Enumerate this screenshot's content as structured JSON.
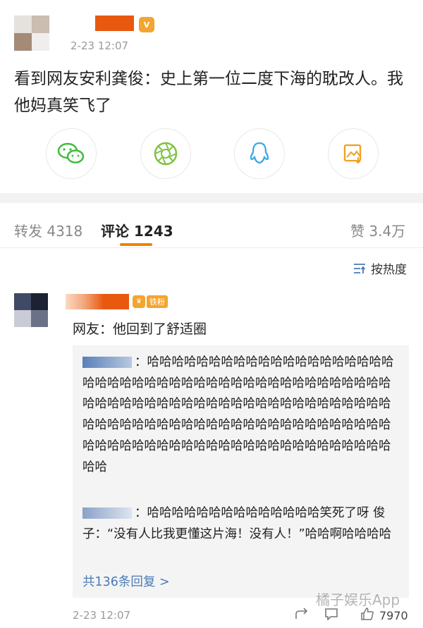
{
  "post": {
    "timestamp": "2-23 12:07",
    "text": "看到网友安利龚俊：史上第一位二度下海的耽改人。我他妈真笑飞了",
    "vip_badge": "V"
  },
  "share": {
    "icons": [
      "wechat-icon",
      "moments-icon",
      "qq-icon",
      "save-image-icon"
    ]
  },
  "tabs": {
    "repost_label": "转发 4318",
    "comment_label": "评论 1243",
    "like_label": "赞 3.4万"
  },
  "sort_label": "按热度",
  "comment": {
    "badge_label": "铁粉",
    "text": "网友：他回到了舒适圈",
    "replies": [
      {
        "text": "：哈哈哈哈哈哈哈哈哈哈哈哈哈哈哈哈哈哈哈哈哈哈哈哈哈哈哈哈哈哈哈哈哈哈哈哈哈哈哈哈哈哈哈哈哈哈哈哈哈哈哈哈哈哈哈哈哈哈哈哈哈哈哈哈哈哈哈哈哈哈哈哈哈哈哈哈哈哈哈哈哈哈哈哈哈哈哈哈哈哈哈哈哈哈哈哈哈哈哈哈哈哈哈哈哈哈哈哈哈哈哈哈哈哈哈哈哈哈哈哈哈哈"
      },
      {
        "text": "：哈哈哈哈哈哈哈哈哈哈哈哈哈哈笑死了呀 俊子：“没有人比我更懂这片海！没有人！”哈哈啊哈哈哈哈"
      }
    ],
    "more_replies": "共136条回复 >",
    "timestamp": "2-23 12:07",
    "likes": "7970"
  },
  "watermark": "橘子娱乐App",
  "colors": {
    "accent": "#f08300",
    "link": "#4a7bb7"
  }
}
